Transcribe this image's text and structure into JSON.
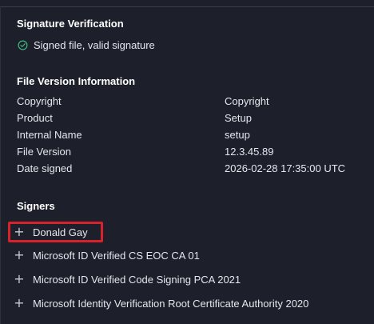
{
  "signature": {
    "title": "Signature Verification",
    "status": "Signed file, valid signature",
    "status_icon": "check-circle-icon"
  },
  "file_version": {
    "title": "File Version Information",
    "rows": [
      {
        "key": "Copyright",
        "value": "Copyright"
      },
      {
        "key": "Product",
        "value": "Setup"
      },
      {
        "key": "Internal Name",
        "value": "setup"
      },
      {
        "key": "File Version",
        "value": "12.3.45.89"
      },
      {
        "key": "Date signed",
        "value": "2026-02-28 17:35:00 UTC"
      }
    ]
  },
  "signers": {
    "title": "Signers",
    "expand_icon": "plus-icon",
    "items": [
      {
        "label": "Donald Gay",
        "highlighted": true
      },
      {
        "label": "Microsoft ID Verified CS EOC CA 01"
      },
      {
        "label": "Microsoft ID Verified Code Signing PCA 2021"
      },
      {
        "label": "Microsoft Identity Verification Root Certificate Authority 2020"
      }
    ]
  },
  "colors": {
    "background": "#1d1f2b",
    "highlight": "#d8222b",
    "check": "#3fb97c"
  }
}
